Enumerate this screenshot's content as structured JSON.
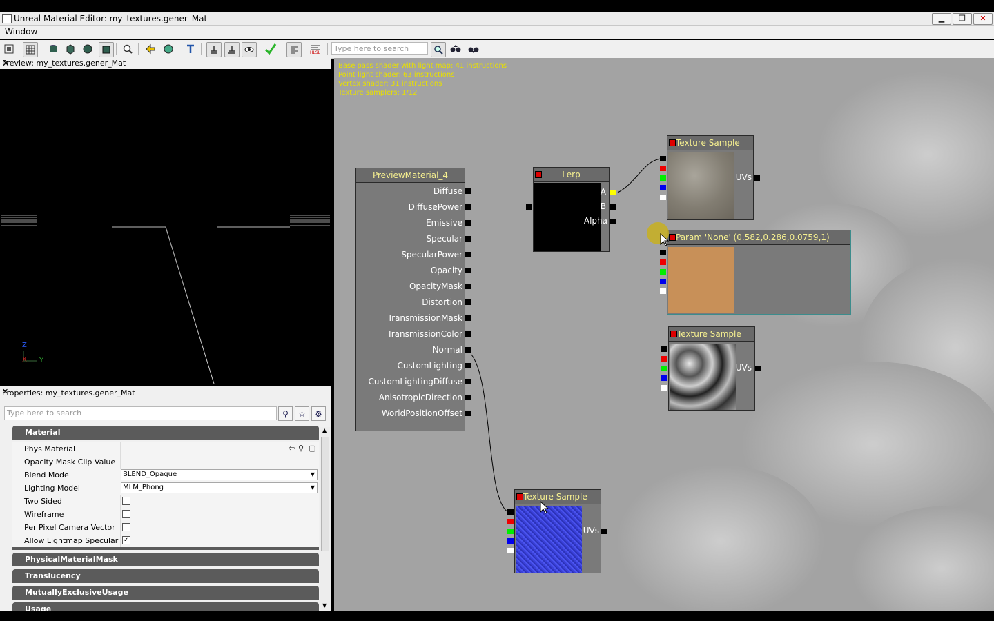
{
  "window": {
    "title": "Unreal Material Editor: my_textures.gener_Mat",
    "minimize": "▁",
    "maximize": "❐",
    "close": "✕"
  },
  "menu": {
    "window_label": "Window"
  },
  "toolbar": {
    "search_placeholder": "Type here to search"
  },
  "preview": {
    "title": "Preview: my_textures.gener_Mat",
    "close": "✕",
    "axis_z": "Z",
    "axis_x": "X",
    "axis_y": "Y"
  },
  "properties": {
    "title": "Properties: my_textures.gener_Mat",
    "close": "✕",
    "search_placeholder": "Type here to search",
    "categories": [
      "Material",
      "PhysicalMaterialMask",
      "Translucency",
      "MutuallyExclusiveUsage",
      "Usage"
    ],
    "rows": {
      "phys_material": "Phys Material",
      "opacity_clip": "Opacity Mask Clip Value",
      "blend_mode": "Blend Mode",
      "blend_mode_value": "BLEND_Opaque",
      "lighting_model": "Lighting Model",
      "lighting_model_value": "MLM_Phong",
      "two_sided": "Two Sided",
      "wireframe": "Wireframe",
      "per_pixel": "Per Pixel Camera Vector",
      "allow_lightmap": "Allow Lightmap Specular",
      "check_mark": "✓"
    }
  },
  "stats": [
    "Base pass shader with light map: 41 instructions",
    "Point light shader: 63 instructions",
    "Vertex shader: 31 instructions",
    "Texture samplers: 1/12"
  ],
  "nodes": {
    "preview_material": {
      "title": "PreviewMaterial_4",
      "inputs": [
        "Diffuse",
        "DiffusePower",
        "Emissive",
        "Specular",
        "SpecularPower",
        "Opacity",
        "OpacityMask",
        "Distortion",
        "TransmissionMask",
        "TransmissionColor",
        "Normal",
        "CustomLighting",
        "CustomLightingDiffuse",
        "AnisotropicDirection",
        "WorldPositionOffset"
      ]
    },
    "lerp": {
      "title": "Lerp",
      "pin_a": "A",
      "pin_b": "B",
      "pin_alpha": "Alpha"
    },
    "texture_sample_1": {
      "title": "Texture Sample",
      "uvs": "UVs"
    },
    "param": {
      "title": "Param 'None' (0.582,0.286,0.0759,1)",
      "color": "#c89058"
    },
    "texture_sample_2": {
      "title": "Texture Sample",
      "uvs": "UVs"
    },
    "texture_sample_3": {
      "title": "Texture Sample",
      "uvs": "UVs"
    }
  },
  "colors": {
    "canvas": "#a3a3a3",
    "stats": "#e8e000",
    "node_title_text": "#f5ef90"
  }
}
